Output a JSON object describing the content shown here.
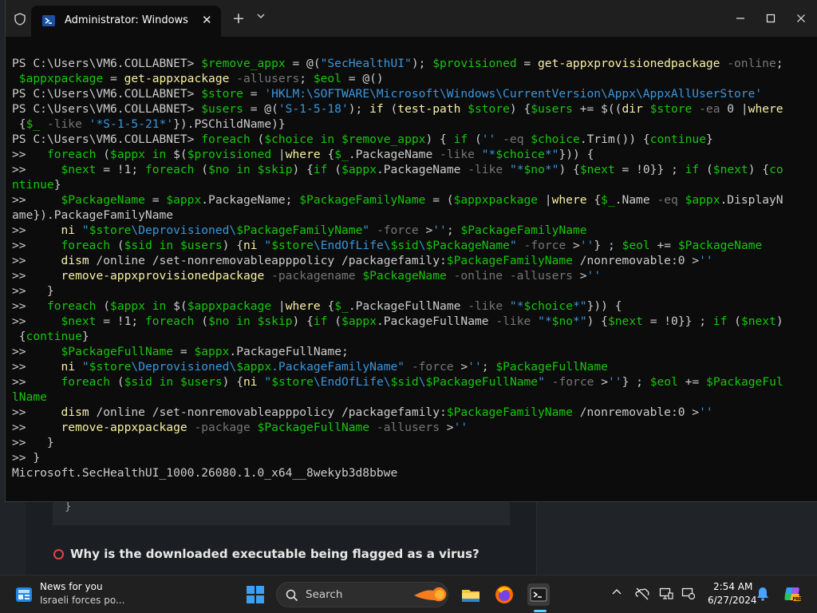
{
  "window": {
    "tab_title": "Administrator: Windows PowerShell",
    "new_tab_symbol": "+",
    "close_tab_symbol": "✕"
  },
  "terminal": {
    "lines": [
      [
        [
          "c",
          "PS C:\\Users\\VM6.COLLABNET> "
        ],
        [
          "g",
          "$remove_appx"
        ],
        [
          "c",
          " = @("
        ],
        [
          "s",
          "\"SecHealthUI\""
        ],
        [
          "c",
          "); "
        ],
        [
          "g",
          "$provisioned"
        ],
        [
          "c",
          " = "
        ],
        [
          "y",
          "get-appxprovisionedpackage"
        ],
        [
          "o",
          " -online"
        ],
        [
          "c",
          ";"
        ]
      ],
      [
        [
          "c",
          " "
        ],
        [
          "g",
          "$appxpackage"
        ],
        [
          "c",
          " = "
        ],
        [
          "y",
          "get-appxpackage"
        ],
        [
          "o",
          " -allusers"
        ],
        [
          "c",
          "; "
        ],
        [
          "g",
          "$eol"
        ],
        [
          "c",
          " = @()"
        ]
      ],
      [
        [
          "c",
          "PS C:\\Users\\VM6.COLLABNET> "
        ],
        [
          "g",
          "$store"
        ],
        [
          "c",
          " = "
        ],
        [
          "s",
          "'HKLM:\\SOFTWARE\\Microsoft\\Windows\\CurrentVersion\\Appx\\AppxAllUserStore'"
        ]
      ],
      [
        [
          "c",
          "PS C:\\Users\\VM6.COLLABNET> "
        ],
        [
          "g",
          "$users"
        ],
        [
          "c",
          " = @("
        ],
        [
          "s",
          "'S-1-5-18'"
        ],
        [
          "c",
          "); "
        ],
        [
          "y",
          "if"
        ],
        [
          "c",
          " ("
        ],
        [
          "y",
          "test-path"
        ],
        [
          "c",
          " "
        ],
        [
          "g",
          "$store"
        ],
        [
          "c",
          ") {"
        ],
        [
          "g",
          "$users"
        ],
        [
          "c",
          " += $(("
        ],
        [
          "y",
          "dir"
        ],
        [
          "c",
          " "
        ],
        [
          "g",
          "$store"
        ],
        [
          "o",
          " -ea"
        ],
        [
          "c",
          " 0 |"
        ],
        [
          "y",
          "where"
        ]
      ],
      [
        [
          "c",
          " {"
        ],
        [
          "g",
          "$_"
        ],
        [
          "o",
          " -like"
        ],
        [
          "c",
          " "
        ],
        [
          "s",
          "'*S-1-5-21*'"
        ],
        [
          "c",
          "}).PSChildName)}"
        ]
      ],
      [
        [
          "c",
          "PS C:\\Users\\VM6.COLLABNET> "
        ],
        [
          "g",
          "foreach"
        ],
        [
          "c",
          " ("
        ],
        [
          "g",
          "$choice"
        ],
        [
          "c",
          " "
        ],
        [
          "g",
          "in"
        ],
        [
          "c",
          " "
        ],
        [
          "g",
          "$remove_appx"
        ],
        [
          "c",
          ") { "
        ],
        [
          "g",
          "if"
        ],
        [
          "c",
          " ("
        ],
        [
          "s",
          "''"
        ],
        [
          "o",
          " -eq"
        ],
        [
          "c",
          " "
        ],
        [
          "g",
          "$choice"
        ],
        [
          "c",
          ".Trim()) {"
        ],
        [
          "g",
          "continue"
        ],
        [
          "c",
          "}"
        ]
      ],
      [
        [
          "c",
          ">>   "
        ],
        [
          "g",
          "foreach"
        ],
        [
          "c",
          " ("
        ],
        [
          "g",
          "$appx"
        ],
        [
          "c",
          " "
        ],
        [
          "g",
          "in"
        ],
        [
          "c",
          " $("
        ],
        [
          "g",
          "$provisioned"
        ],
        [
          "c",
          " |"
        ],
        [
          "y",
          "where"
        ],
        [
          "c",
          " {"
        ],
        [
          "g",
          "$_"
        ],
        [
          "c",
          ".PackageName"
        ],
        [
          "o",
          " -like"
        ],
        [
          "c",
          " "
        ],
        [
          "s",
          "\"*"
        ],
        [
          "g",
          "$choice"
        ],
        [
          "s",
          "*\""
        ],
        [
          "c",
          "})) {"
        ]
      ],
      [
        [
          "c",
          ">>     "
        ],
        [
          "g",
          "$next"
        ],
        [
          "c",
          " = !1; "
        ],
        [
          "g",
          "foreach"
        ],
        [
          "c",
          " ("
        ],
        [
          "g",
          "$no"
        ],
        [
          "c",
          " "
        ],
        [
          "g",
          "in"
        ],
        [
          "c",
          " "
        ],
        [
          "g",
          "$skip"
        ],
        [
          "c",
          ") {"
        ],
        [
          "g",
          "if"
        ],
        [
          "c",
          " ("
        ],
        [
          "g",
          "$appx"
        ],
        [
          "c",
          ".PackageName"
        ],
        [
          "o",
          " -like"
        ],
        [
          "c",
          " "
        ],
        [
          "s",
          "\"*"
        ],
        [
          "g",
          "$no"
        ],
        [
          "s",
          "*\""
        ],
        [
          "c",
          ") {"
        ],
        [
          "g",
          "$next"
        ],
        [
          "c",
          " = !0}} ; "
        ],
        [
          "g",
          "if"
        ],
        [
          "c",
          " ("
        ],
        [
          "g",
          "$next"
        ],
        [
          "c",
          ") {"
        ],
        [
          "g",
          "co"
        ]
      ],
      [
        [
          "g",
          "ntinue"
        ],
        [
          "c",
          "}"
        ]
      ],
      [
        [
          "c",
          ">>     "
        ],
        [
          "g",
          "$PackageName"
        ],
        [
          "c",
          " = "
        ],
        [
          "g",
          "$appx"
        ],
        [
          "c",
          ".PackageName; "
        ],
        [
          "g",
          "$PackageFamilyName"
        ],
        [
          "c",
          " = ("
        ],
        [
          "g",
          "$appxpackage"
        ],
        [
          "c",
          " |"
        ],
        [
          "y",
          "where"
        ],
        [
          "c",
          " {"
        ],
        [
          "g",
          "$_"
        ],
        [
          "c",
          ".Name"
        ],
        [
          "o",
          " -eq"
        ],
        [
          "c",
          " "
        ],
        [
          "g",
          "$appx"
        ],
        [
          "c",
          ".DisplayN"
        ]
      ],
      [
        [
          "c",
          "ame}).PackageFamilyName"
        ]
      ],
      [
        [
          "c",
          ">>     "
        ],
        [
          "y",
          "ni"
        ],
        [
          "c",
          " "
        ],
        [
          "s",
          "\""
        ],
        [
          "g",
          "$store"
        ],
        [
          "s",
          "\\Deprovisioned\\"
        ],
        [
          "g",
          "$PackageFamilyName"
        ],
        [
          "s",
          "\""
        ],
        [
          "o",
          " -force"
        ],
        [
          "c",
          " >"
        ],
        [
          "s",
          "''"
        ],
        [
          "c",
          "; "
        ],
        [
          "g",
          "$PackageFamilyName"
        ]
      ],
      [
        [
          "c",
          ">>     "
        ],
        [
          "g",
          "foreach"
        ],
        [
          "c",
          " ("
        ],
        [
          "g",
          "$sid"
        ],
        [
          "c",
          " "
        ],
        [
          "g",
          "in"
        ],
        [
          "c",
          " "
        ],
        [
          "g",
          "$users"
        ],
        [
          "c",
          ") {"
        ],
        [
          "y",
          "ni"
        ],
        [
          "c",
          " "
        ],
        [
          "s",
          "\""
        ],
        [
          "g",
          "$store"
        ],
        [
          "s",
          "\\EndOfLife\\"
        ],
        [
          "g",
          "$sid"
        ],
        [
          "s",
          "\\"
        ],
        [
          "g",
          "$PackageName"
        ],
        [
          "s",
          "\""
        ],
        [
          "o",
          " -force"
        ],
        [
          "c",
          " >"
        ],
        [
          "s",
          "''"
        ],
        [
          "c",
          "} ; "
        ],
        [
          "g",
          "$eol"
        ],
        [
          "c",
          " += "
        ],
        [
          "g",
          "$PackageName"
        ]
      ],
      [
        [
          "c",
          ">>     "
        ],
        [
          "y",
          "dism"
        ],
        [
          "c",
          " /online /set-nonremovableapppolicy /packagefamily:"
        ],
        [
          "g",
          "$PackageFamilyName"
        ],
        [
          "c",
          " /nonremovable:0 >"
        ],
        [
          "s",
          "''"
        ]
      ],
      [
        [
          "c",
          ">>     "
        ],
        [
          "y",
          "remove-appxprovisionedpackage"
        ],
        [
          "o",
          " -packagename"
        ],
        [
          "c",
          " "
        ],
        [
          "g",
          "$PackageName"
        ],
        [
          "o",
          " -online -allusers"
        ],
        [
          "c",
          " >"
        ],
        [
          "s",
          "''"
        ]
      ],
      [
        [
          "c",
          ">>   }"
        ]
      ],
      [
        [
          "c",
          ">>   "
        ],
        [
          "g",
          "foreach"
        ],
        [
          "c",
          " ("
        ],
        [
          "g",
          "$appx"
        ],
        [
          "c",
          " "
        ],
        [
          "g",
          "in"
        ],
        [
          "c",
          " $("
        ],
        [
          "g",
          "$appxpackage"
        ],
        [
          "c",
          " |"
        ],
        [
          "y",
          "where"
        ],
        [
          "c",
          " {"
        ],
        [
          "g",
          "$_"
        ],
        [
          "c",
          ".PackageFullName"
        ],
        [
          "o",
          " -like"
        ],
        [
          "c",
          " "
        ],
        [
          "s",
          "\"*"
        ],
        [
          "g",
          "$choice"
        ],
        [
          "s",
          "*\""
        ],
        [
          "c",
          "})) {"
        ]
      ],
      [
        [
          "c",
          ">>     "
        ],
        [
          "g",
          "$next"
        ],
        [
          "c",
          " = !1; "
        ],
        [
          "g",
          "foreach"
        ],
        [
          "c",
          " ("
        ],
        [
          "g",
          "$no"
        ],
        [
          "c",
          " "
        ],
        [
          "g",
          "in"
        ],
        [
          "c",
          " "
        ],
        [
          "g",
          "$skip"
        ],
        [
          "c",
          ") {"
        ],
        [
          "g",
          "if"
        ],
        [
          "c",
          " ("
        ],
        [
          "g",
          "$appx"
        ],
        [
          "c",
          ".PackageFullName"
        ],
        [
          "o",
          " -like"
        ],
        [
          "c",
          " "
        ],
        [
          "s",
          "\"*"
        ],
        [
          "g",
          "$no"
        ],
        [
          "s",
          "*\""
        ],
        [
          "c",
          ") {"
        ],
        [
          "g",
          "$next"
        ],
        [
          "c",
          " = !0}} ; "
        ],
        [
          "g",
          "if"
        ],
        [
          "c",
          " ("
        ],
        [
          "g",
          "$next"
        ],
        [
          "c",
          ")"
        ]
      ],
      [
        [
          "c",
          " {"
        ],
        [
          "g",
          "continue"
        ],
        [
          "c",
          "}"
        ]
      ],
      [
        [
          "c",
          ">>     "
        ],
        [
          "g",
          "$PackageFullName"
        ],
        [
          "c",
          " = "
        ],
        [
          "g",
          "$appx"
        ],
        [
          "c",
          ".PackageFullName;"
        ]
      ],
      [
        [
          "c",
          ">>     "
        ],
        [
          "y",
          "ni"
        ],
        [
          "c",
          " "
        ],
        [
          "s",
          "\""
        ],
        [
          "g",
          "$store"
        ],
        [
          "s",
          "\\Deprovisioned\\"
        ],
        [
          "g",
          "$appx"
        ],
        [
          "s",
          ".PackageFamilyName\""
        ],
        [
          "o",
          " -force"
        ],
        [
          "c",
          " >"
        ],
        [
          "s",
          "''"
        ],
        [
          "c",
          "; "
        ],
        [
          "g",
          "$PackageFullName"
        ]
      ],
      [
        [
          "c",
          ">>     "
        ],
        [
          "g",
          "foreach"
        ],
        [
          "c",
          " ("
        ],
        [
          "g",
          "$sid"
        ],
        [
          "c",
          " "
        ],
        [
          "g",
          "in"
        ],
        [
          "c",
          " "
        ],
        [
          "g",
          "$users"
        ],
        [
          "c",
          ") {"
        ],
        [
          "y",
          "ni"
        ],
        [
          "c",
          " "
        ],
        [
          "s",
          "\""
        ],
        [
          "g",
          "$store"
        ],
        [
          "s",
          "\\EndOfLife\\"
        ],
        [
          "g",
          "$sid"
        ],
        [
          "s",
          "\\"
        ],
        [
          "g",
          "$PackageFullName"
        ],
        [
          "s",
          "\""
        ],
        [
          "o",
          " -force"
        ],
        [
          "c",
          " >"
        ],
        [
          "s",
          "''"
        ],
        [
          "c",
          "} ; "
        ],
        [
          "g",
          "$eol"
        ],
        [
          "c",
          " += "
        ],
        [
          "g",
          "$PackageFul"
        ]
      ],
      [
        [
          "g",
          "lName"
        ]
      ],
      [
        [
          "c",
          ">>     "
        ],
        [
          "y",
          "dism"
        ],
        [
          "c",
          " /online /set-nonremovableapppolicy /packagefamily:"
        ],
        [
          "g",
          "$PackageFamilyName"
        ],
        [
          "c",
          " /nonremovable:0 >"
        ],
        [
          "s",
          "''"
        ]
      ],
      [
        [
          "c",
          ">>     "
        ],
        [
          "y",
          "remove-appxpackage"
        ],
        [
          "o",
          " -package"
        ],
        [
          "c",
          " "
        ],
        [
          "g",
          "$PackageFullName"
        ],
        [
          "o",
          " -allusers"
        ],
        [
          "c",
          " >"
        ],
        [
          "s",
          "''"
        ]
      ],
      [
        [
          "c",
          ">>   }"
        ]
      ],
      [
        [
          "c",
          ">> }"
        ]
      ],
      [
        [
          "c",
          "Microsoft.SecHealthUI_1000.26080.1.0_x64__8wekyb3d8bbwe"
        ]
      ]
    ]
  },
  "background_page": {
    "code_brace": "}",
    "question": "Why is the downloaded executable being flagged as a virus?"
  },
  "taskbar": {
    "news_title": "News for you",
    "news_subtitle": "Israeli forces po...",
    "search_label": "Search",
    "time": "2:54 AM",
    "date": "6/27/2024"
  }
}
